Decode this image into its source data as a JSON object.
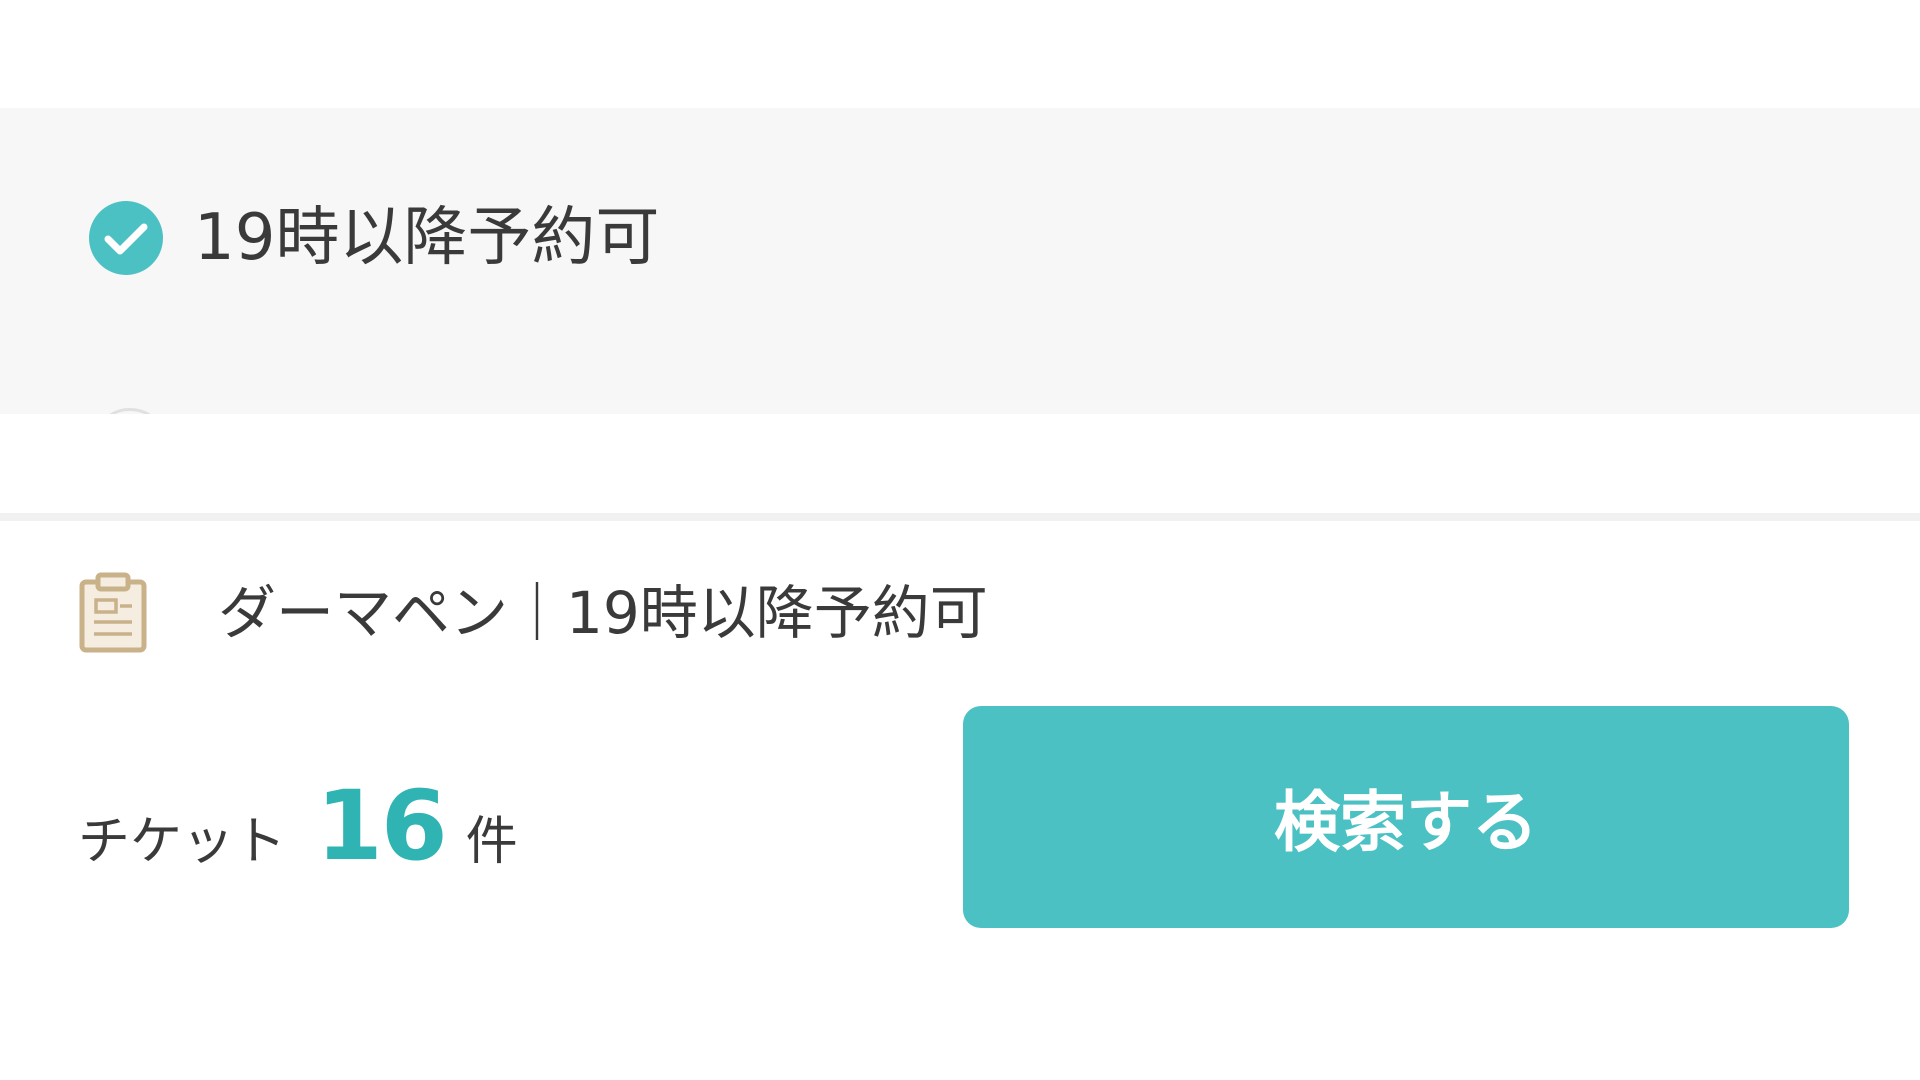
{
  "filter": {
    "option_label": "19時以降予約可",
    "option_checked": true,
    "check_icon": "check-circle-icon"
  },
  "summary": {
    "icon": "clipboard-icon",
    "text": "ダーマペン｜19時以降予約可"
  },
  "result": {
    "prefix": "チケット",
    "count": "16",
    "suffix": "件"
  },
  "search_button": {
    "label": "検索する"
  },
  "colors": {
    "accent": "#4cc1c3",
    "count_text": "#2fb3b3",
    "panel_bg": "#f7f7f7",
    "icon_tan": "#c9b28a"
  }
}
